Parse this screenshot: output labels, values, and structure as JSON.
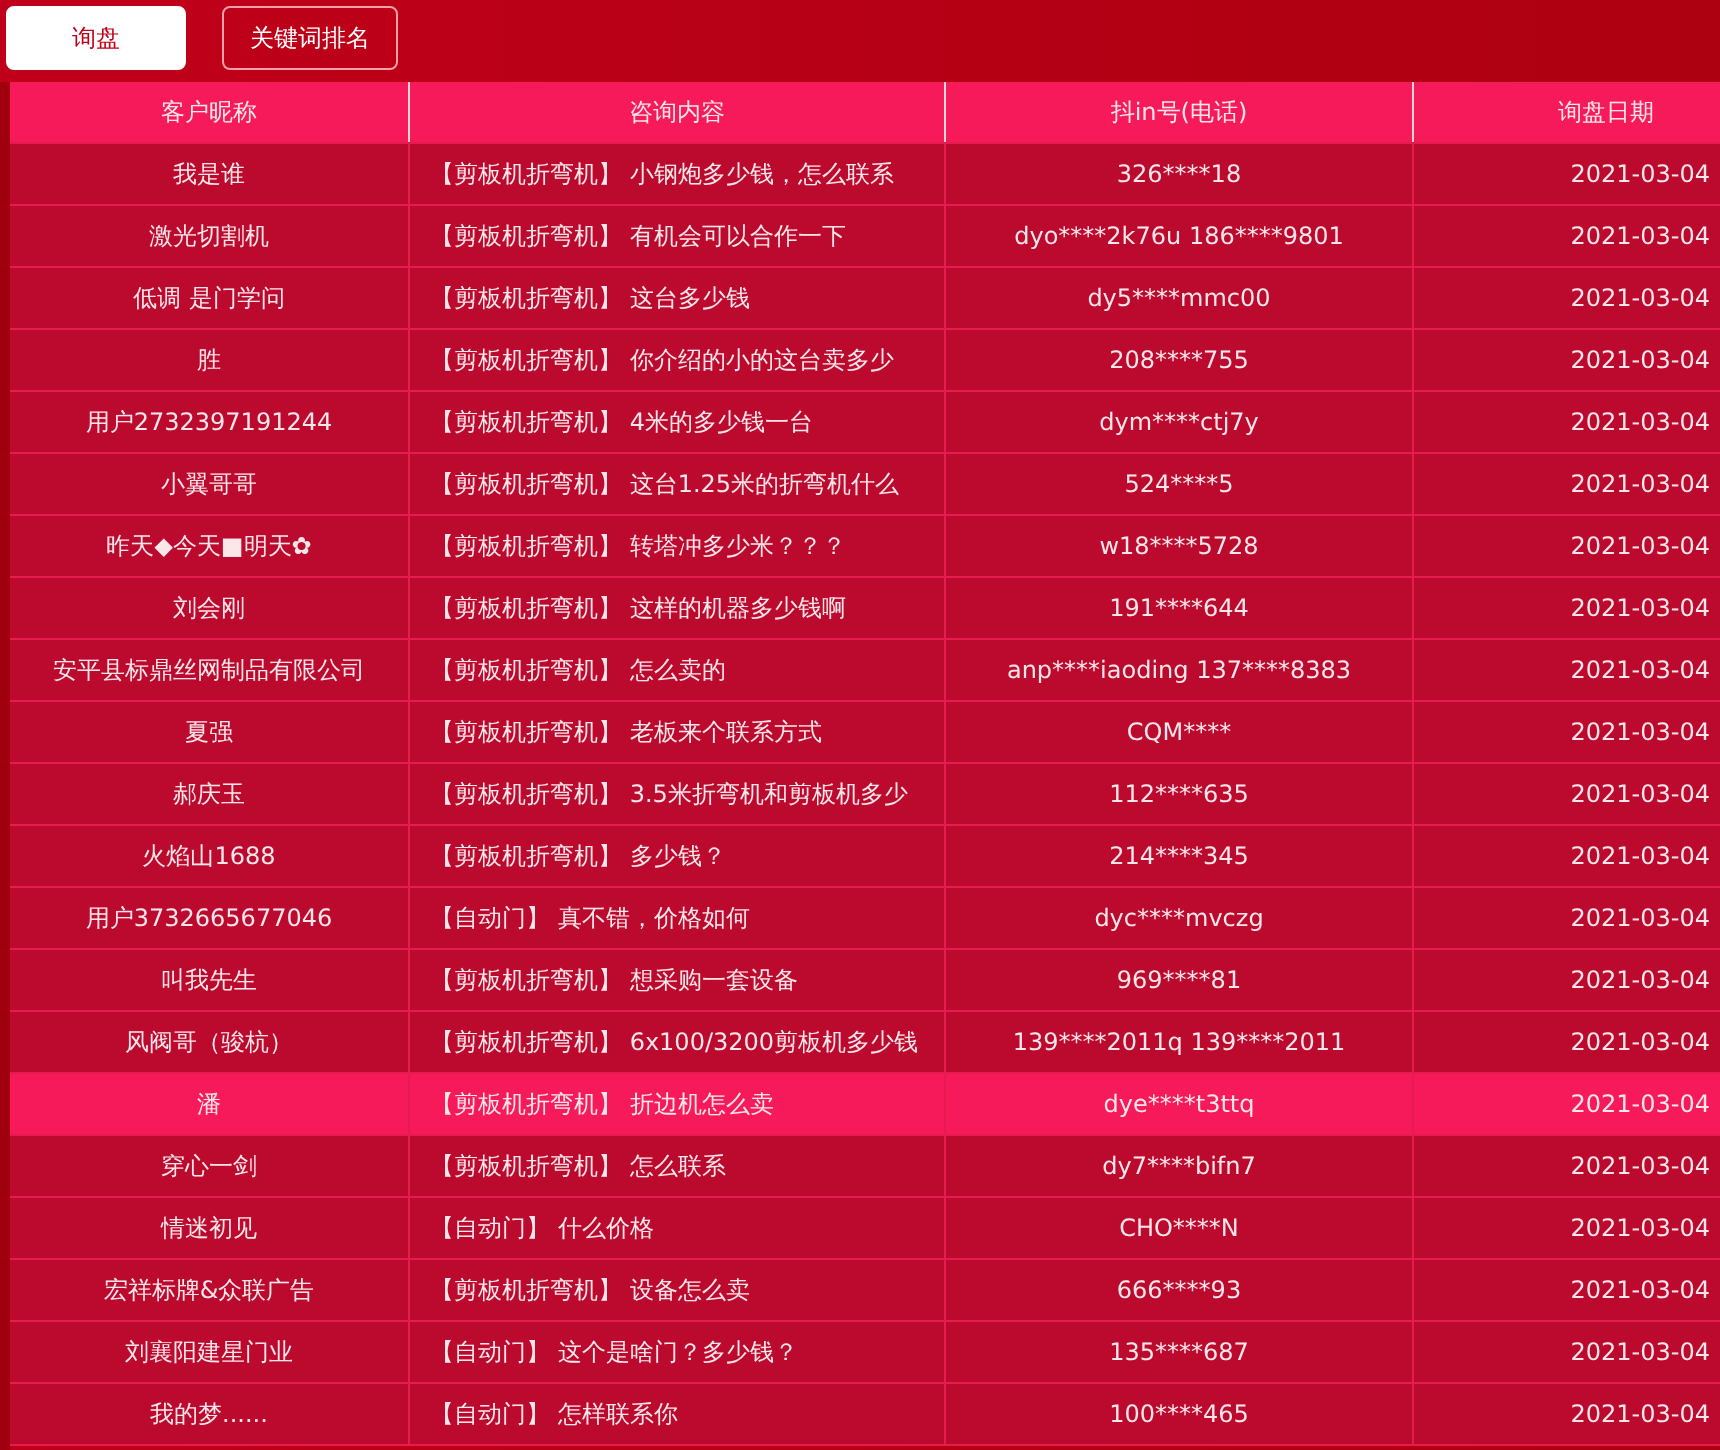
{
  "tabs": [
    {
      "label": "询盘",
      "selected": true
    },
    {
      "label": "关键词排名",
      "selected": false
    }
  ],
  "table": {
    "columns": [
      "客户昵称",
      "咨询内容",
      "抖in号(电话)",
      "询盘日期"
    ],
    "rows": [
      {
        "name": "我是谁",
        "content": "【剪板机折弯机】 小钢炮多少钱，怎么联系",
        "contact": "326****18",
        "date": "2021-03-04",
        "selected": false
      },
      {
        "name": "激光切割机",
        "content": "【剪板机折弯机】 有机会可以合作一下",
        "contact": "dyo****2k76u 186****9801",
        "date": "2021-03-04",
        "selected": false
      },
      {
        "name": "低调 是门学问",
        "content": "【剪板机折弯机】 这台多少钱",
        "contact": "dy5****mmc00",
        "date": "2021-03-04",
        "selected": false
      },
      {
        "name": "胜",
        "content": "【剪板机折弯机】 你介绍的小的这台卖多少",
        "contact": "208****755",
        "date": "2021-03-04",
        "selected": false
      },
      {
        "name": "用户2732397191244",
        "content": "【剪板机折弯机】 4米的多少钱一台",
        "contact": "dym****ctj7y",
        "date": "2021-03-04",
        "selected": false
      },
      {
        "name": "小翼哥哥",
        "content": "【剪板机折弯机】 这台1.25米的折弯机什么",
        "contact": "524****5",
        "date": "2021-03-04",
        "selected": false
      },
      {
        "name": "昨天◆今天■明天✿",
        "content": "【剪板机折弯机】 转塔冲多少米？？？",
        "contact": "w18****5728",
        "date": "2021-03-04",
        "selected": false
      },
      {
        "name": "刘会刚",
        "content": "【剪板机折弯机】 这样的机器多少钱啊",
        "contact": "191****644",
        "date": "2021-03-04",
        "selected": false
      },
      {
        "name": "安平县标鼎丝网制品有限公司",
        "content": "【剪板机折弯机】 怎么卖的",
        "contact": "anp****iaoding 137****8383",
        "date": "2021-03-04",
        "selected": false
      },
      {
        "name": "夏强",
        "content": "【剪板机折弯机】 老板来个联系方式",
        "contact": "CQM****",
        "date": "2021-03-04",
        "selected": false
      },
      {
        "name": "郝庆玉",
        "content": "【剪板机折弯机】 3.5米折弯机和剪板机多少",
        "contact": "112****635",
        "date": "2021-03-04",
        "selected": false
      },
      {
        "name": "火焰山1688",
        "content": "【剪板机折弯机】 多少钱？",
        "contact": "214****345",
        "date": "2021-03-04",
        "selected": false
      },
      {
        "name": "用户3732665677046",
        "content": "【自动门】 真不错，价格如何",
        "contact": "dyc****mvczg",
        "date": "2021-03-04",
        "selected": false
      },
      {
        "name": "叫我先生",
        "content": "【剪板机折弯机】 想采购一套设备",
        "contact": "969****81",
        "date": "2021-03-04",
        "selected": false
      },
      {
        "name": "风阀哥（骏杭）",
        "content": "【剪板机折弯机】 6x100/3200剪板机多少钱",
        "contact": "139****2011q 139****2011",
        "date": "2021-03-04",
        "selected": false
      },
      {
        "name": "潘",
        "content": "【剪板机折弯机】 折边机怎么卖",
        "contact": "dye****t3ttq",
        "date": "2021-03-04",
        "selected": true
      },
      {
        "name": "穿心一剑",
        "content": "【剪板机折弯机】 怎么联系",
        "contact": "dy7****bifn7",
        "date": "2021-03-04",
        "selected": false
      },
      {
        "name": "情迷初见",
        "content": "【自动门】 什么价格",
        "contact": "CHO****N",
        "date": "2021-03-04",
        "selected": false
      },
      {
        "name": "宏祥标牌&众联广告",
        "content": "【剪板机折弯机】 设备怎么卖",
        "contact": "666****93",
        "date": "2021-03-04",
        "selected": false
      },
      {
        "name": "刘襄阳建星门业",
        "content": "【自动门】 这个是啥门？多少钱？",
        "contact": "135****687",
        "date": "2021-03-04",
        "selected": false
      },
      {
        "name": "我的梦......",
        "content": "【自动门】 怎样联系你",
        "contact": "100****465",
        "date": "2021-03-04",
        "selected": false
      }
    ]
  }
}
